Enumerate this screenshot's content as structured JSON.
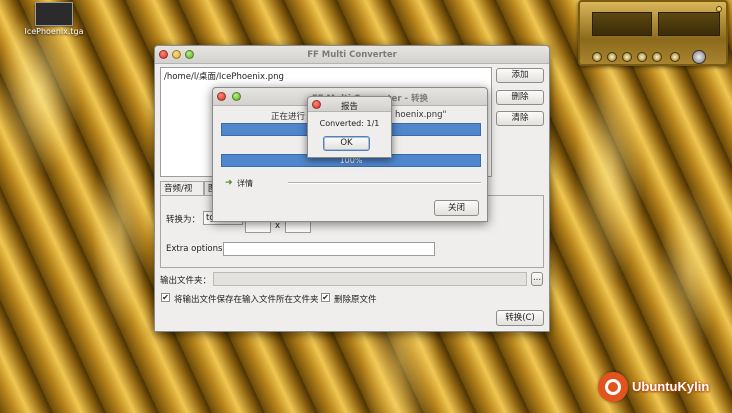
{
  "desktop": {
    "icon_label": "IcePhoenix.tga"
  },
  "main_window": {
    "title": "FF Multi Converter",
    "files": [
      "/home/l/桌面/IcePhoenix.png"
    ],
    "buttons": {
      "add": "添加",
      "remove": "删除",
      "clear": "清除"
    },
    "tabs": [
      "音频/视频",
      "图"
    ],
    "convert_to_label": "转换为：",
    "convert_to_value": "tg",
    "size_separator": "x",
    "extra_options_label": "Extra options:",
    "extra_options_value": "",
    "output_folder_label": "输出文件夹：",
    "output_folder_value": "",
    "browse_label": "...",
    "save_in_input_folder_label": "将输出文件保存在输入文件所在文件夹",
    "save_in_input_folder_checked": true,
    "delete_original_label": "删除原文件",
    "delete_original_checked": true,
    "convert_button": "转换(C)"
  },
  "progress_dialog": {
    "title": "FF Multi Converter - 转换",
    "status_prefix": "正在进行",
    "status_suffix": "hoenix.png\"",
    "progress1_percent": 100,
    "progress2_text": "100%",
    "progress2_percent": 100,
    "details_label": "详情",
    "close_button": "关闭"
  },
  "report_dialog": {
    "title": "报告",
    "message": "Converted: 1/1",
    "ok_button": "OK"
  },
  "brand": {
    "text": "UbuntuKylin"
  },
  "colors": {
    "progress_blue": "#4f86cc",
    "brand_orange": "#e2541d",
    "close_red": "#d8281b"
  }
}
